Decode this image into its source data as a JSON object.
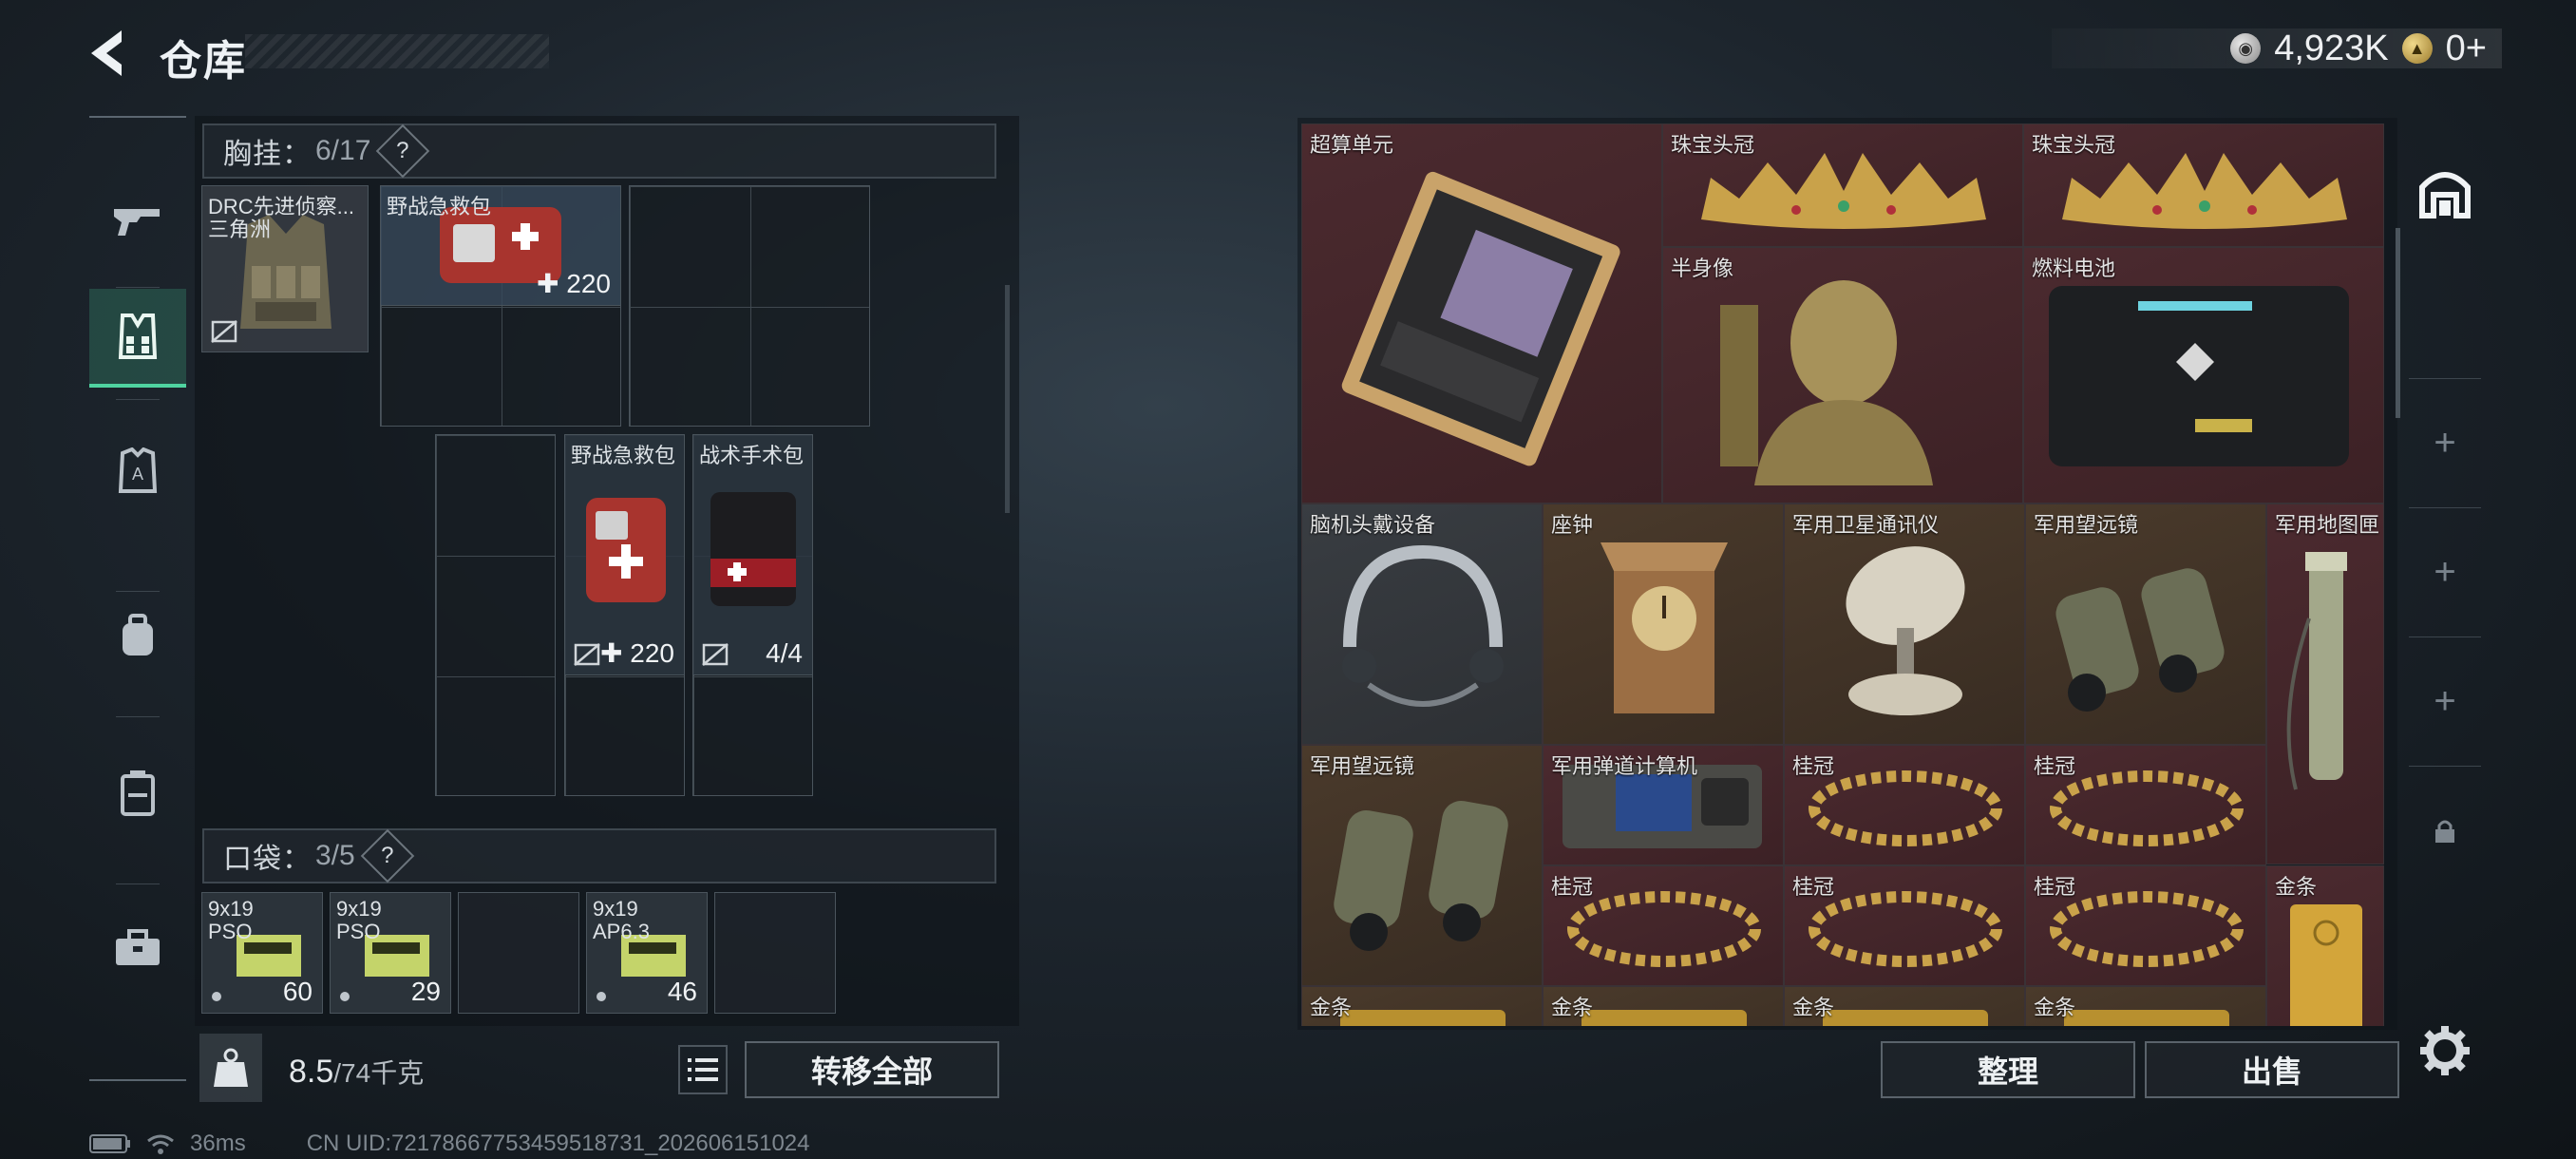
{
  "header": {
    "title": "仓库"
  },
  "currency": {
    "silver": "4,923K",
    "gold": "0+"
  },
  "nav": {
    "items": [
      {
        "name": "weapons",
        "icon": "gun-icon"
      },
      {
        "name": "chest-rig",
        "icon": "vest-icon",
        "active": true
      },
      {
        "name": "armor",
        "icon": "armor-icon"
      },
      {
        "name": "backpack",
        "icon": "backpack-icon"
      },
      {
        "name": "case",
        "icon": "case-icon"
      },
      {
        "name": "toolbox",
        "icon": "toolbox-icon"
      }
    ]
  },
  "chest_rig": {
    "label": "胸挂：",
    "count": "6/17",
    "help": "?",
    "equipped": {
      "name": "DRC先进侦察...",
      "sub": "三角洲"
    },
    "items": [
      {
        "name": "野战急救包",
        "count": "220"
      },
      {
        "name": "野战急救包",
        "count": "220"
      },
      {
        "name": "战术手术包",
        "count": "4/4"
      }
    ]
  },
  "pockets": {
    "label": "口袋：",
    "count": "3/5",
    "help": "?",
    "items": [
      {
        "name": "9x19",
        "sub": "PSO",
        "count": "60"
      },
      {
        "name": "9x19",
        "sub": "PSO",
        "count": "29"
      },
      {
        "name": "9x19",
        "sub": "AP6.3",
        "count": "46"
      }
    ]
  },
  "weight": {
    "current": "8.5",
    "max": "/74千克"
  },
  "buttons": {
    "transfer_all": "转移全部",
    "sort": "整理",
    "sell": "出售"
  },
  "status": {
    "ping": "36ms",
    "uid": "CN UID:72178667753459518731_202606151024"
  },
  "stash": {
    "items": [
      {
        "name": "超算单元"
      },
      {
        "name": "珠宝头冠"
      },
      {
        "name": "珠宝头冠"
      },
      {
        "name": "半身像"
      },
      {
        "name": "燃料电池"
      },
      {
        "name": "脑机头戴设备"
      },
      {
        "name": "座钟"
      },
      {
        "name": "军用卫星通讯仪"
      },
      {
        "name": "军用望远镜"
      },
      {
        "name": "军用地图匣"
      },
      {
        "name": "军用望远镜"
      },
      {
        "name": "军用弹道计算机"
      },
      {
        "name": "桂冠"
      },
      {
        "name": "桂冠"
      },
      {
        "name": "桂冠"
      },
      {
        "name": "桂冠"
      },
      {
        "name": "桂冠"
      },
      {
        "name": "金条"
      },
      {
        "name": "金条"
      },
      {
        "name": "金条"
      },
      {
        "name": "金条"
      },
      {
        "name": "金条"
      }
    ]
  },
  "side_slots": [
    "+",
    "+",
    "+"
  ],
  "colors": {
    "accent": "#4fd3a0",
    "tile_red": "#4b2a2f",
    "tile_gold": "#4a3a2b"
  }
}
